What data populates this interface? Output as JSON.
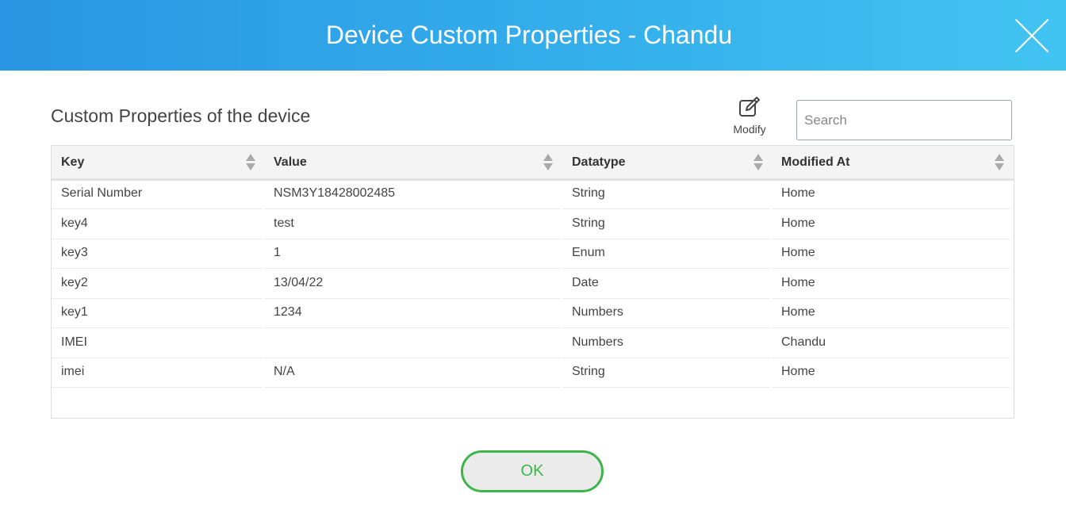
{
  "dialog": {
    "title": "Device Custom Properties - Chandu",
    "close_icon": "close-icon",
    "header_gradient": [
      "#2a95e4",
      "#42c4f2"
    ]
  },
  "section": {
    "heading": "Custom Properties of the device"
  },
  "toolbar": {
    "modify_label": "Modify",
    "modify_icon": "edit-icon",
    "search_placeholder": "Search"
  },
  "table": {
    "columns": [
      {
        "label": "Key"
      },
      {
        "label": "Value"
      },
      {
        "label": "Datatype"
      },
      {
        "label": "Modified At"
      }
    ],
    "rows": [
      {
        "key": "Serial Number",
        "value": "NSM3Y18428002485",
        "datatype": "String",
        "modified_at": "Home"
      },
      {
        "key": "key4",
        "value": "test",
        "datatype": "String",
        "modified_at": "Home"
      },
      {
        "key": "key3",
        "value": "1",
        "datatype": "Enum",
        "modified_at": "Home"
      },
      {
        "key": "key2",
        "value": "13/04/22",
        "datatype": "Date",
        "modified_at": "Home"
      },
      {
        "key": "key1",
        "value": "1234",
        "datatype": "Numbers",
        "modified_at": "Home"
      },
      {
        "key": "IMEI",
        "value": "",
        "datatype": "Numbers",
        "modified_at": "Chandu"
      },
      {
        "key": "imei",
        "value": "N/A",
        "datatype": "String",
        "modified_at": "Home"
      }
    ]
  },
  "footer": {
    "ok_label": "OK",
    "ok_color": "#3db54a"
  }
}
